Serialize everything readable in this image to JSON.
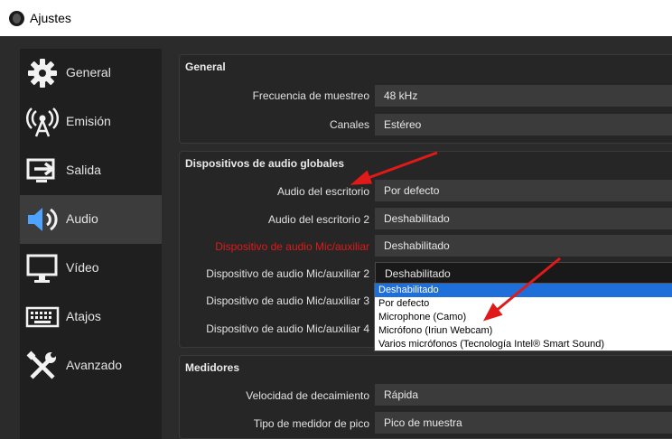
{
  "window": {
    "title": "Ajustes"
  },
  "sidebar": {
    "items": [
      {
        "label": "General",
        "icon": "gear-icon"
      },
      {
        "label": "Emisión",
        "icon": "broadcast-icon"
      },
      {
        "label": "Salida",
        "icon": "output-icon"
      },
      {
        "label": "Audio",
        "icon": "speaker-icon",
        "active": true
      },
      {
        "label": "Vídeo",
        "icon": "monitor-icon"
      },
      {
        "label": "Atajos",
        "icon": "keyboard-icon"
      },
      {
        "label": "Avanzado",
        "icon": "tools-icon"
      }
    ]
  },
  "general": {
    "title": "General",
    "sample_rate_label": "Frecuencia de muestreo",
    "sample_rate_value": "48 kHz",
    "channels_label": "Canales",
    "channels_value": "Estéreo"
  },
  "devices": {
    "title": "Dispositivos de audio globales",
    "rows": [
      {
        "label": "Audio del escritorio",
        "value": "Por defecto"
      },
      {
        "label": "Audio del escritorio 2",
        "value": "Deshabilitado"
      },
      {
        "label": "Dispositivo de audio Mic/auxiliar",
        "value": "Deshabilitado"
      },
      {
        "label": "Dispositivo de audio Mic/auxiliar 2",
        "value": "Deshabilitado"
      },
      {
        "label": "Dispositivo de audio Mic/auxiliar 3",
        "value": ""
      },
      {
        "label": "Dispositivo de audio Mic/auxiliar 4",
        "value": ""
      }
    ],
    "dropdown_options": [
      "Deshabilitado",
      "Por defecto",
      "Microphone (Camo)",
      "Micrófono (Iriun Webcam)",
      "Varios micrófonos (Tecnología Intel® Smart Sound)"
    ]
  },
  "meters": {
    "title": "Medidores",
    "decay_label": "Velocidad de decaimiento",
    "decay_value": "Rápida",
    "peak_label": "Tipo de medidor de pico",
    "peak_value": "Pico de muestra"
  },
  "colors": {
    "background": "#2b2b2b",
    "sidebar": "#1f1f1f",
    "highlight": "#1e6fd9",
    "annotation_red": "#e01919"
  }
}
